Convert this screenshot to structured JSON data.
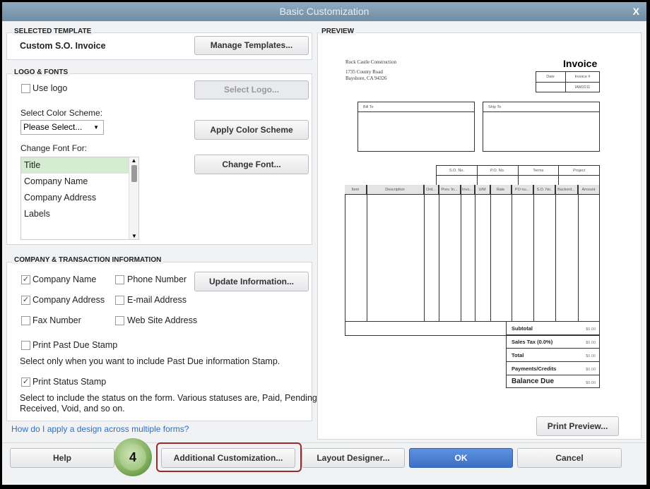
{
  "window": {
    "title": "Basic Customization",
    "close": "X"
  },
  "selected_template": {
    "heading": "SELECTED TEMPLATE",
    "name": "Custom S.O. Invoice",
    "manage_button": "Manage Templates..."
  },
  "logo_fonts": {
    "heading": "LOGO & FONTS",
    "use_logo": "Use logo",
    "use_logo_checked": false,
    "select_logo": "Select Logo...",
    "color_scheme_label": "Select Color Scheme:",
    "color_scheme_value": "Please Select...",
    "apply_color": "Apply Color Scheme",
    "change_font_label": "Change Font For:",
    "font_items": [
      "Title",
      "Company Name",
      "Company Address",
      "Labels"
    ],
    "selected_font_item": "Title",
    "change_font_button": "Change Font..."
  },
  "company_info": {
    "heading": "COMPANY & TRANSACTION INFORMATION",
    "company_name": "Company Name",
    "company_address": "Company Address",
    "fax": "Fax Number",
    "phone": "Phone Number",
    "email": "E-mail Address",
    "website": "Web Site Address",
    "update_button": "Update Information...",
    "past_due": "Print Past Due Stamp",
    "past_due_note": "Select only when you want to include Past Due information Stamp.",
    "status_stamp": "Print Status Stamp",
    "status_note_1": "Select to include the status on the form. Various statuses are, Paid, Pending,",
    "status_note_2": "Received, Void, and so on.",
    "check_mark": "✓"
  },
  "help_link": "How do I apply a design across multiple forms?",
  "preview": {
    "heading": "PREVIEW",
    "company": "Rock Castle Construction",
    "address1": "1735 County Road",
    "address2": "Bayshore, CA 94326",
    "doc_title": "Invoice",
    "date_label": "Date",
    "invoice_label": "Invoice #",
    "invoice_no": "IAM2011",
    "bill_to": "Bill To",
    "ship_to": "Ship To",
    "info_cols": [
      "S.O. No.",
      "P.O. No.",
      "Terms",
      "Project"
    ],
    "item_cols": [
      "Item",
      "Description",
      "Ord...",
      "Prev. In...",
      "Invo...",
      "U/M",
      "Rate",
      "PO nu...",
      "S.O. No.",
      "Backord...",
      "Amount"
    ],
    "totals": [
      {
        "label": "Subtotal",
        "value": "$0.00"
      },
      {
        "label": "Sales Tax  (0.0%)",
        "value": "$0.00"
      },
      {
        "label": "Total",
        "value": "$0.00"
      },
      {
        "label": "Payments/Credits",
        "value": "$0.00"
      },
      {
        "label": "Balance Due",
        "value": "$0.00"
      }
    ],
    "print_preview": "Print Preview..."
  },
  "footer": {
    "help": "Help",
    "step_badge": "4",
    "additional": "Additional Customization...",
    "layout": "Layout Designer...",
    "ok": "OK",
    "cancel": "Cancel"
  },
  "colors": {
    "ok_blue": "#4a7fd0",
    "badge_green": "#7fae5c",
    "highlight_red": "#9b2a2a"
  }
}
